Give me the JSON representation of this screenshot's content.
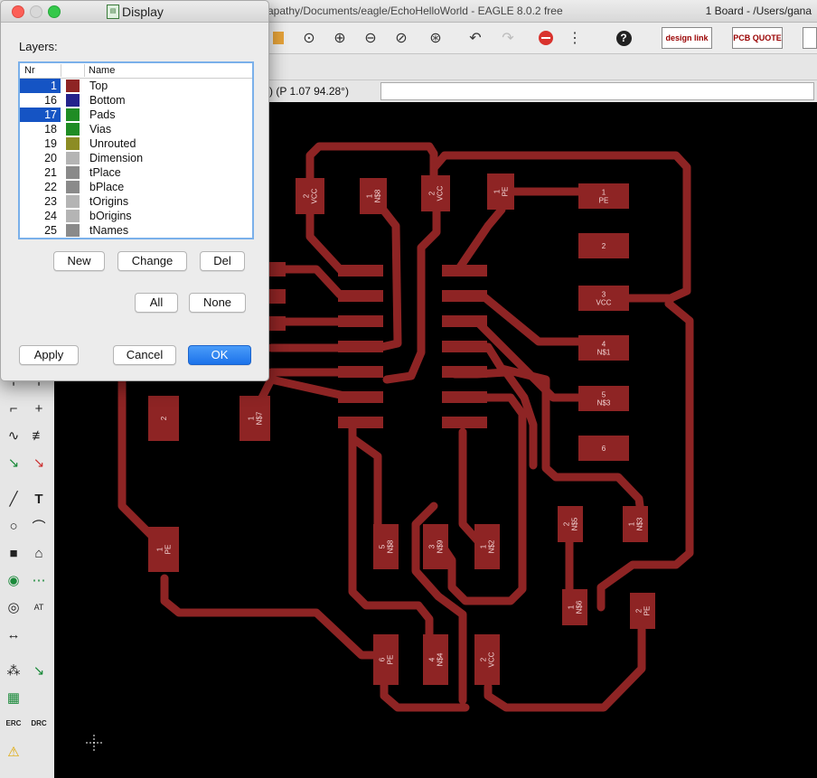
{
  "window": {
    "title": "apathy/Documents/eagle/EchoHelloWorld - EAGLE 8.0.2 free",
    "right_title": "1 Board - /Users/gana"
  },
  "coordbar": {
    "coordinate": ") (P 1.07 94.28°)"
  },
  "dialog": {
    "title": "Display",
    "layers_label": "Layers:",
    "columns": {
      "nr": "Nr",
      "name": "Name"
    },
    "layers": [
      {
        "nr": "1",
        "name": "Top",
        "color": "#8e2424",
        "selected": true
      },
      {
        "nr": "16",
        "name": "Bottom",
        "color": "#24238c",
        "selected": false
      },
      {
        "nr": "17",
        "name": "Pads",
        "color": "#1f8c24",
        "selected": true
      },
      {
        "nr": "18",
        "name": "Vias",
        "color": "#1f8c24",
        "selected": false
      },
      {
        "nr": "19",
        "name": "Unrouted",
        "color": "#8c8c24",
        "selected": false
      },
      {
        "nr": "20",
        "name": "Dimension",
        "color": "#b4b4b4",
        "selected": false
      },
      {
        "nr": "21",
        "name": "tPlace",
        "color": "#8a8a8a",
        "selected": false
      },
      {
        "nr": "22",
        "name": "bPlace",
        "color": "#8a8a8a",
        "selected": false
      },
      {
        "nr": "23",
        "name": "tOrigins",
        "color": "#b4b4b4",
        "selected": false
      },
      {
        "nr": "24",
        "name": "bOrigins",
        "color": "#b4b4b4",
        "selected": false
      },
      {
        "nr": "25",
        "name": "tNames",
        "color": "#8a8a8a",
        "selected": false
      }
    ],
    "buttons": {
      "new": "New",
      "change": "Change",
      "del": "Del",
      "all": "All",
      "none": "None",
      "apply": "Apply",
      "cancel": "Cancel",
      "ok": "OK"
    }
  },
  "toolbar": {
    "design_link": "design link",
    "pcb_quote": "PCB QUOTE"
  },
  "lefttools": {
    "text_tool": "T",
    "erc": "ERC",
    "drc": "DRC"
  },
  "board": {
    "trace_color": "#8e2424",
    "pad_labels": [
      {
        "id": "p1",
        "text": "2\nVCC"
      },
      {
        "id": "p2",
        "text": "1\nN$8"
      },
      {
        "id": "p3",
        "text": "2\nVCC"
      },
      {
        "id": "p4",
        "text": "1\nPE"
      },
      {
        "id": "p5",
        "text": "1\nPE"
      },
      {
        "id": "p6",
        "text": "2"
      },
      {
        "id": "p7",
        "text": "3\nVCC"
      },
      {
        "id": "p8",
        "text": "4\nN$1"
      },
      {
        "id": "p9",
        "text": "5\nN$3"
      },
      {
        "id": "p10",
        "text": "6"
      },
      {
        "id": "p11",
        "text": "1\nN$7"
      },
      {
        "id": "p12",
        "text": "2"
      },
      {
        "id": "p13",
        "text": "1\nPE"
      },
      {
        "id": "p14",
        "text": "5\nN$8"
      },
      {
        "id": "p15",
        "text": "3\nN$9"
      },
      {
        "id": "p16",
        "text": "1\nN$2"
      },
      {
        "id": "p17",
        "text": "2\nN$5"
      },
      {
        "id": "p18",
        "text": "1\nN$6"
      },
      {
        "id": "p19",
        "text": "1\nN$3"
      },
      {
        "id": "p20",
        "text": "2\nPE"
      },
      {
        "id": "p21",
        "text": "6\nPE"
      },
      {
        "id": "p22",
        "text": "4\nN$4"
      },
      {
        "id": "p23",
        "text": "2\nVCC"
      }
    ]
  }
}
